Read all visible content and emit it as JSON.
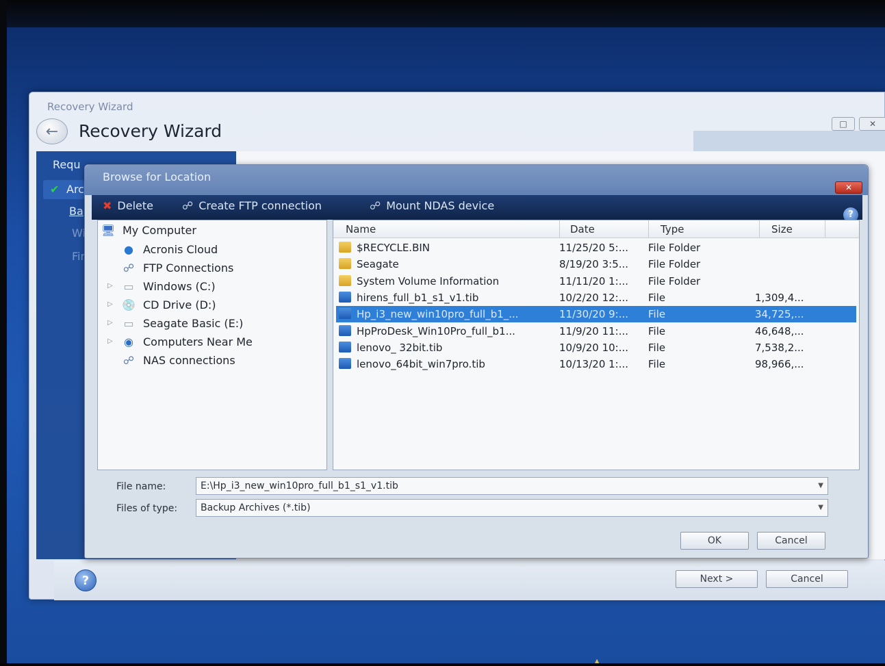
{
  "wizard": {
    "caption": "Recovery Wizard",
    "title": "Recovery Wizard",
    "sidebar_visible": [
      "Requ",
      "Arc",
      "Ba",
      "Wi",
      "Fir"
    ],
    "next_label": "Next >",
    "cancel_label": "Cancel"
  },
  "dialog": {
    "title": "Browse for Location",
    "toolbar": {
      "delete": "Delete",
      "create_ftp": "Create FTP connection",
      "mount_ndas": "Mount NDAS device"
    },
    "tree": [
      {
        "label": "My Computer",
        "icon": "computer-icon",
        "expander": false
      },
      {
        "label": "Acronis Cloud",
        "icon": "cloud-icon",
        "expander": false
      },
      {
        "label": "FTP Connections",
        "icon": "network-icon",
        "expander": false
      },
      {
        "label": "Windows  (C:)",
        "icon": "drive-icon",
        "expander": true
      },
      {
        "label": "CD Drive (D:)",
        "icon": "cd-drive-icon",
        "expander": true
      },
      {
        "label": "Seagate Basic (E:)",
        "icon": "drive-icon",
        "expander": true
      },
      {
        "label": "Computers Near Me",
        "icon": "globe-icon",
        "expander": true
      },
      {
        "label": "NAS connections",
        "icon": "network-icon",
        "expander": false
      }
    ],
    "columns": {
      "name": "Name",
      "date": "Date",
      "type": "Type",
      "size": "Size"
    },
    "files": [
      {
        "name": "$RECYCLE.BIN",
        "date": "11/25/20 5:...",
        "type": "File Folder",
        "size": "",
        "kind": "folder",
        "selected": false
      },
      {
        "name": "Seagate",
        "date": "8/19/20 3:5...",
        "type": "File Folder",
        "size": "",
        "kind": "folder",
        "selected": false
      },
      {
        "name": "System Volume Information",
        "date": "11/11/20 1:...",
        "type": "File Folder",
        "size": "",
        "kind": "folder",
        "selected": false
      },
      {
        "name": "hirens_full_b1_s1_v1.tib",
        "date": "10/2/20 12:...",
        "type": "File",
        "size": "1,309,4...",
        "kind": "file",
        "selected": false
      },
      {
        "name": "Hp_i3_new_win10pro_full_b1_...",
        "date": "11/30/20 9:...",
        "type": "File",
        "size": "34,725,...",
        "kind": "file",
        "selected": true
      },
      {
        "name": "HpProDesk_Win10Pro_full_b1...",
        "date": "11/9/20 11:...",
        "type": "File",
        "size": "46,648,...",
        "kind": "file",
        "selected": false
      },
      {
        "name": "lenovo_ 32bit.tib",
        "date": "10/9/20 10:...",
        "type": "File",
        "size": "7,538,2...",
        "kind": "file",
        "selected": false
      },
      {
        "name": "lenovo_64bit_win7pro.tib",
        "date": "10/13/20 1:...",
        "type": "File",
        "size": "98,966,...",
        "kind": "file",
        "selected": false
      }
    ],
    "file_name_label": "File name:",
    "file_name_value": "E:\\Hp_i3_new_win10pro_full_b1_s1_v1.tib",
    "file_type_label": "Files of type:",
    "file_type_value": "Backup Archives (*.tib)",
    "ok_label": "OK",
    "cancel_label": "Cancel"
  },
  "colors": {
    "selection": "#2e7fd8",
    "toolbar": "#1f3d73",
    "sidebar": "#1f4e9c"
  }
}
